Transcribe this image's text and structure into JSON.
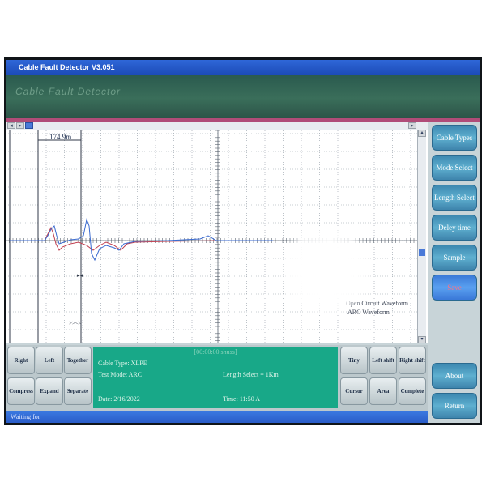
{
  "window": {
    "title": "Cable Fault Detector  V3.051"
  },
  "banner": {
    "text": "Cable Fault Detector"
  },
  "scope": {
    "cursor_readout": "174.9m",
    "legend": [
      "Open Circuit Waveform",
      "ARC Waveform"
    ],
    "colors": {
      "open_circuit": "#c04050",
      "arc": "#3a6ad0",
      "grid": "#909aa4",
      "cursor": "#303848"
    }
  },
  "side_buttons": [
    "Cable Types",
    "Mode Select",
    "Length Select",
    "Deley time",
    "Sample",
    "Save",
    "About",
    "Return"
  ],
  "left_buttons": [
    "Right",
    "Left",
    "Together",
    "Compress",
    "Expand",
    "Separate"
  ],
  "right_buttons": [
    "Tiny",
    "Left shift",
    "Right shift",
    "Cursor",
    "Area",
    "Complete"
  ],
  "info": {
    "header": "[00:00:00 shuss]",
    "cable_type": "Cable Type: XLPE",
    "test_mode": "Test Mode: ARC",
    "length_select": "Length Select = 1Km",
    "date": "Date: 2/16/2022",
    "time": "Time: 11:50 A"
  },
  "status": {
    "text": "Waiting for"
  }
}
